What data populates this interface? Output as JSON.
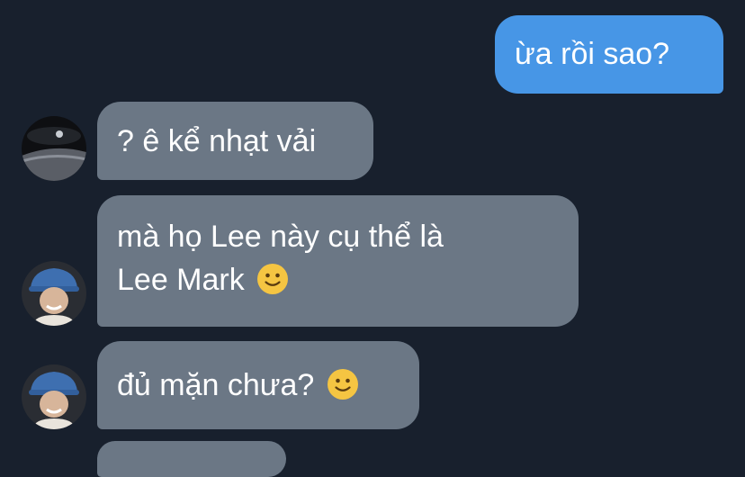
{
  "messages": [
    {
      "sender": "me",
      "text": "ừa rồi sao?"
    },
    {
      "sender": "other-1",
      "text": "? ê kể nhạt vải"
    },
    {
      "sender": "other-2",
      "line1": "mà họ Lee này cụ thể là",
      "line2": "Lee Mark",
      "emoji": "slightly-smiling-face"
    },
    {
      "sender": "other-2",
      "text": "đủ mặn chưa?",
      "emoji": "slightly-smiling-face"
    }
  ],
  "colors": {
    "background": "#18202d",
    "outgoing_bubble": "#4796e6",
    "incoming_bubble": "#6b7785",
    "text": "#ffffff"
  }
}
